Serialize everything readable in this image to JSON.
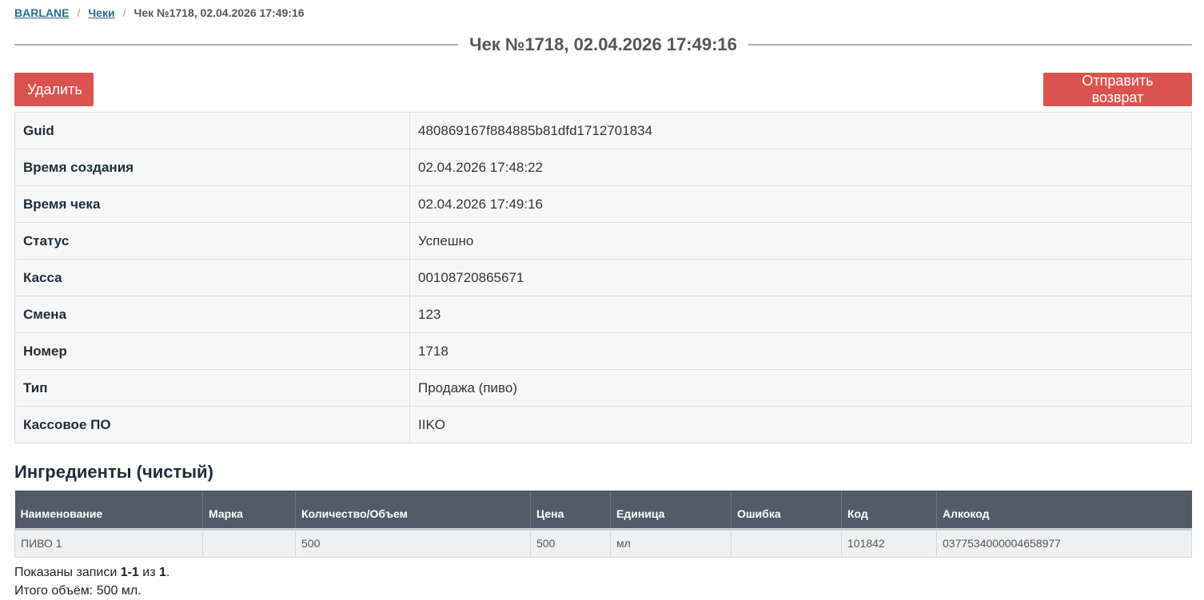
{
  "breadcrumb": {
    "home": "BARLANE",
    "section": "Чеки",
    "current": "Чек №1718, 02.04.2026 17:49:16"
  },
  "page_title": "Чек №1718, 02.04.2026 17:49:16",
  "actions": {
    "delete_label": "Удалить",
    "return_label": "Отправить возврат"
  },
  "details": [
    {
      "key": "Guid",
      "value": "480869167f884885b81dfd1712701834"
    },
    {
      "key": "Время создания",
      "value": "02.04.2026 17:48:22"
    },
    {
      "key": "Время чека",
      "value": "02.04.2026 17:49:16"
    },
    {
      "key": "Статус",
      "value": "Успешно"
    },
    {
      "key": "Касса",
      "value": "00108720865671"
    },
    {
      "key": "Смена",
      "value": "123"
    },
    {
      "key": "Номер",
      "value": "1718"
    },
    {
      "key": "Тип",
      "value": "Продажа (пиво)"
    },
    {
      "key": "Кассовое ПО",
      "value": "IIKO"
    }
  ],
  "ingredients": {
    "title": "Ингредиенты (чистый)",
    "columns": [
      "Наименование",
      "Марка",
      "Количество/Объем",
      "Цена",
      "Единица",
      "Ошибка",
      "Код",
      "Алкокод"
    ],
    "rows": [
      [
        "ПИВО 1",
        "",
        "500",
        "500",
        "мл",
        "",
        "101842",
        "0377534000004658977"
      ]
    ]
  },
  "summary": {
    "shown_prefix": "Показаны записи ",
    "shown_range": "1-1",
    "shown_of": " из ",
    "shown_total": "1",
    "shown_suffix": ".",
    "total_volume": "Итого объём: 500 мл."
  },
  "colors": {
    "danger": "#d9534f",
    "table_header": "#525b67",
    "link": "#2a6b8a"
  }
}
